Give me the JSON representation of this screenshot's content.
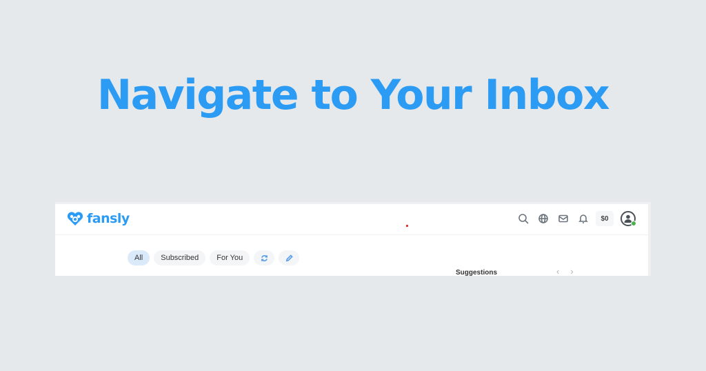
{
  "headline": "Navigate to Your Inbox",
  "app": {
    "brand": "fansly",
    "balance": "$0",
    "nav_icons": [
      "search-icon",
      "globe-icon",
      "mail-icon",
      "bell-icon"
    ],
    "filters": {
      "all": "All",
      "subscribed": "Subscribed",
      "for_you": "For You"
    },
    "suggestions_title": "Suggestions",
    "prev": "‹",
    "next": "›"
  }
}
